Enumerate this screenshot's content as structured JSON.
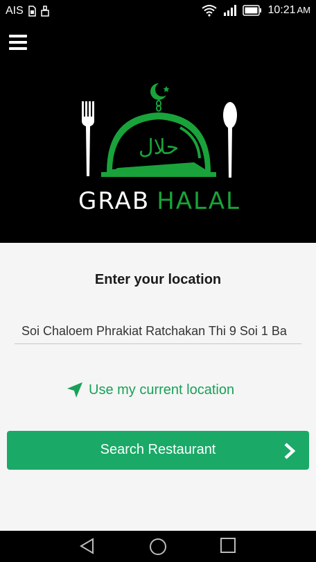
{
  "status_bar": {
    "carrier": "AIS",
    "time": "10:21",
    "ampm": "AM"
  },
  "header": {
    "logo_word1": "GRAB",
    "logo_word2": "HALAL",
    "logo_arabic": "حلال"
  },
  "main": {
    "title": "Enter your location",
    "location_value": "Soi Chaloem Phrakiat Ratchakan Thi 9 Soi 1 Ba",
    "use_location_label": "Use my current location",
    "search_button_label": "Search Restaurant"
  },
  "colors": {
    "brand_green": "#19a33a",
    "button_green": "#1aa967",
    "link_green": "#18a058"
  }
}
